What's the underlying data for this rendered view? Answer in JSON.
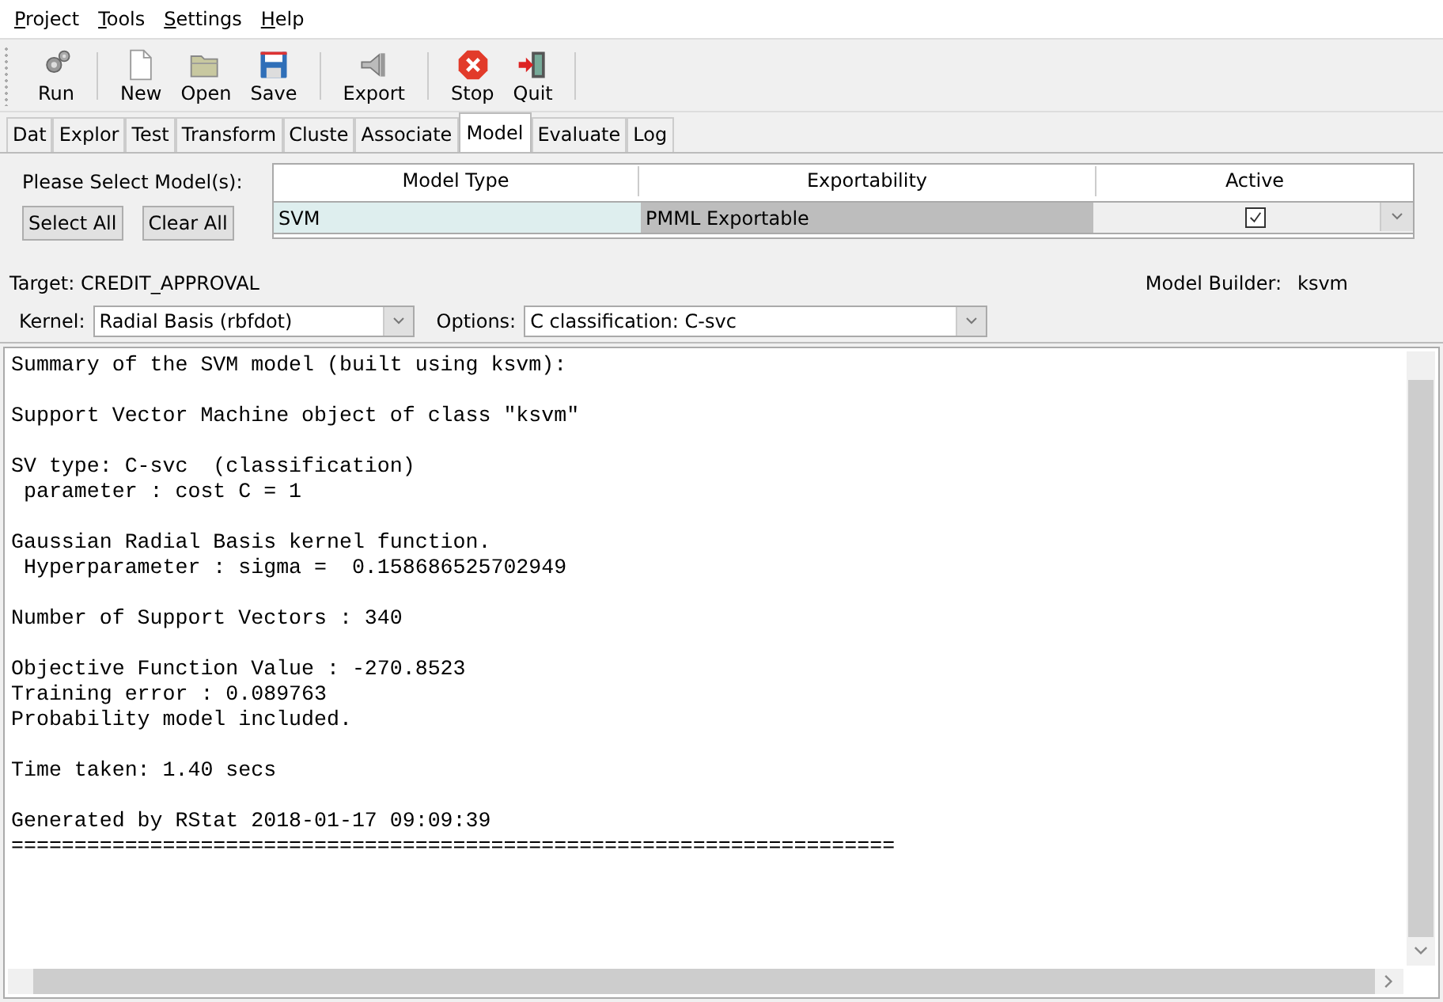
{
  "menu": [
    {
      "label": "Project"
    },
    {
      "label": "Tools"
    },
    {
      "label": "Settings"
    },
    {
      "label": "Help"
    }
  ],
  "toolbar_groups": [
    [
      {
        "label": "Run",
        "kind": "run"
      }
    ],
    [
      {
        "label": "New",
        "kind": "new"
      },
      {
        "label": "Open",
        "kind": "open"
      },
      {
        "label": "Save",
        "kind": "save"
      }
    ],
    [
      {
        "label": "Export",
        "kind": "export"
      }
    ],
    [
      {
        "label": "Stop",
        "kind": "stop"
      },
      {
        "label": "Quit",
        "kind": "quit"
      }
    ]
  ],
  "tabs": [
    {
      "label": "Dat",
      "selected": false
    },
    {
      "label": "Explor",
      "selected": false
    },
    {
      "label": "Test",
      "selected": false
    },
    {
      "label": "Transform",
      "selected": false
    },
    {
      "label": "Cluste",
      "selected": false
    },
    {
      "label": "Associate",
      "selected": false
    },
    {
      "label": "Model",
      "selected": true
    },
    {
      "label": "Evaluate",
      "selected": false
    },
    {
      "label": "Log",
      "selected": false
    }
  ],
  "model_panel": {
    "prompt": "Please Select Model(s):",
    "buttons": [
      "Select All",
      "Clear All"
    ],
    "grid": {
      "columns": [
        "Model Type",
        "Exportability",
        "Active"
      ],
      "rows": [
        {
          "model_type": "SVM",
          "exportability": "PMML Exportable",
          "active": true
        }
      ]
    },
    "target": "Target: CREDIT_APPROVAL",
    "model_builder": {
      "label": "Model Builder:",
      "value": "ksvm"
    },
    "kernel": {
      "label": "Kernel:",
      "value": "Radial Basis (rbfdot)"
    },
    "options": {
      "label": "Options:",
      "value": "C classification: C-svc"
    }
  },
  "output": [
    [
      "Summary of the SVM model (built using ksvm):"
    ],
    [
      "Support Vector Machine object of class \"ksvm\""
    ],
    [
      "SV type: C-svc  (classification)",
      " parameter : cost C = 1"
    ],
    [
      "Gaussian Radial Basis kernel function.",
      " Hyperparameter : sigma =  0.158686525702949"
    ],
    [
      "Number of Support Vectors : 340"
    ],
    [
      "Objective Function Value : -270.8523",
      "Training error : 0.089763",
      "Probability model included."
    ],
    [
      "Time taken: 1.40 secs"
    ],
    [
      "Generated by RStat 2018-01-17 09:09:39",
      "======================================================================"
    ]
  ]
}
